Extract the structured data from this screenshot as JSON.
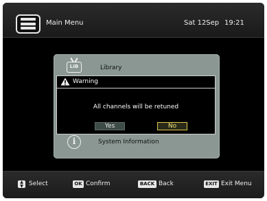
{
  "header": {
    "title": "Main Menu",
    "date": "Sat 12Sep",
    "time": "19:21",
    "icon": "menu-list-icon"
  },
  "menu": {
    "items": [
      {
        "label": "Library",
        "icon": "tv-library-icon",
        "icon_text": "LIB"
      },
      {
        "label": "System Information",
        "icon": "info-icon",
        "icon_text": "i"
      }
    ]
  },
  "dialog": {
    "title": "Warning",
    "icon": "warning-icon",
    "message": "All channels will be retuned",
    "buttons": {
      "yes": "Yes",
      "no": "No"
    },
    "selected": "No"
  },
  "footer": {
    "select": {
      "key": "⇅",
      "label": "Select"
    },
    "confirm": {
      "key": "OK",
      "label": "Confirm"
    },
    "back": {
      "key": "BACK",
      "label": "Back"
    },
    "exit": {
      "key": "EXIT",
      "label": "Exit Menu"
    }
  },
  "colors": {
    "panel": "#8a9793",
    "dialog_bg": "#000000",
    "selected_border": "#e3c94a",
    "selected_text": "#f4e27a"
  }
}
